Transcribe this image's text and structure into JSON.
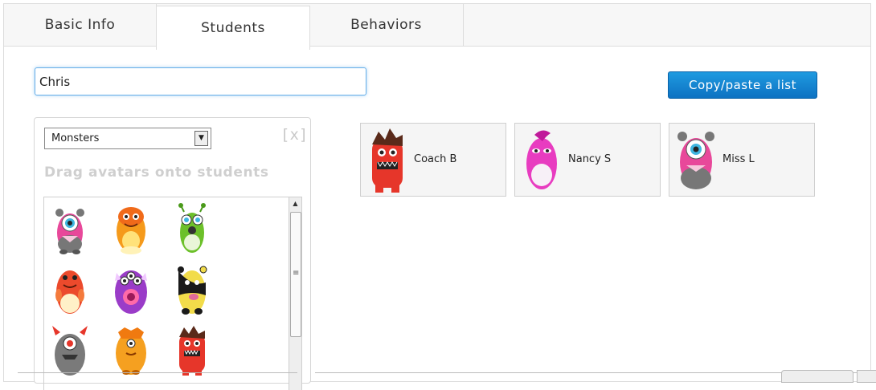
{
  "tabs": [
    {
      "label": "Basic Info",
      "active": false
    },
    {
      "label": "Students",
      "active": true
    },
    {
      "label": "Behaviors",
      "active": false
    }
  ],
  "search": {
    "value": "Chris"
  },
  "copy_button": {
    "label": "Copy/paste a list"
  },
  "avatar_picker": {
    "category": "Monsters",
    "close_label": "[x]",
    "hint": "Drag avatars onto students",
    "avatars": [
      {
        "name": "pink-cyclops",
        "color": "#e8489a"
      },
      {
        "name": "orange-monster",
        "color": "#f59a1b"
      },
      {
        "name": "green-alien",
        "color": "#6cc02a"
      },
      {
        "name": "red-monster",
        "color": "#ec4a2c"
      },
      {
        "name": "purple-monster",
        "color": "#9a3cc8"
      },
      {
        "name": "yellow-black-monster",
        "color": "#f2dc4a"
      },
      {
        "name": "gray-horned-monster",
        "color": "#7a7a7a"
      },
      {
        "name": "orange-furry-monster",
        "color": "#f5a020"
      },
      {
        "name": "red-spiky-monster",
        "color": "#e6362a"
      }
    ]
  },
  "students": [
    {
      "name": "Coach B",
      "avatar": "red-spiky-monster",
      "color": "#e6362a"
    },
    {
      "name": "Nancy S",
      "avatar": "magenta-monster",
      "color": "#e83cc0"
    },
    {
      "name": "Miss L",
      "avatar": "pink-cyclops",
      "color": "#e8489a"
    }
  ],
  "colors": {
    "accent": "#1483d2",
    "tab_bg": "#f7f7f7",
    "border": "#dcdcdc"
  }
}
